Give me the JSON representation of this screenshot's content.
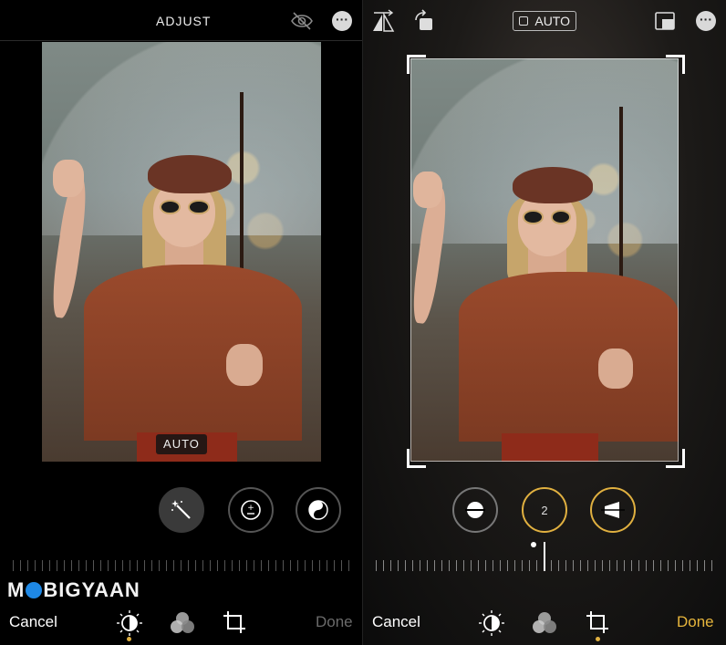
{
  "left": {
    "header": {
      "title": "ADJUST"
    },
    "photo": {
      "auto_badge": "AUTO"
    },
    "tools": [
      "auto-enhance",
      "exposure",
      "brilliance"
    ],
    "watermark": "MOBIGYAAN",
    "bottom": {
      "cancel": "Cancel",
      "done": "Done"
    }
  },
  "right": {
    "header": {
      "auto_label": "AUTO"
    },
    "tools": {
      "straighten_value": "2"
    },
    "bottom": {
      "cancel": "Cancel",
      "done": "Done"
    }
  },
  "colors": {
    "accent": "#e0b040",
    "done_active": "#e6b53c",
    "done_inactive": "#6b6b6b"
  }
}
